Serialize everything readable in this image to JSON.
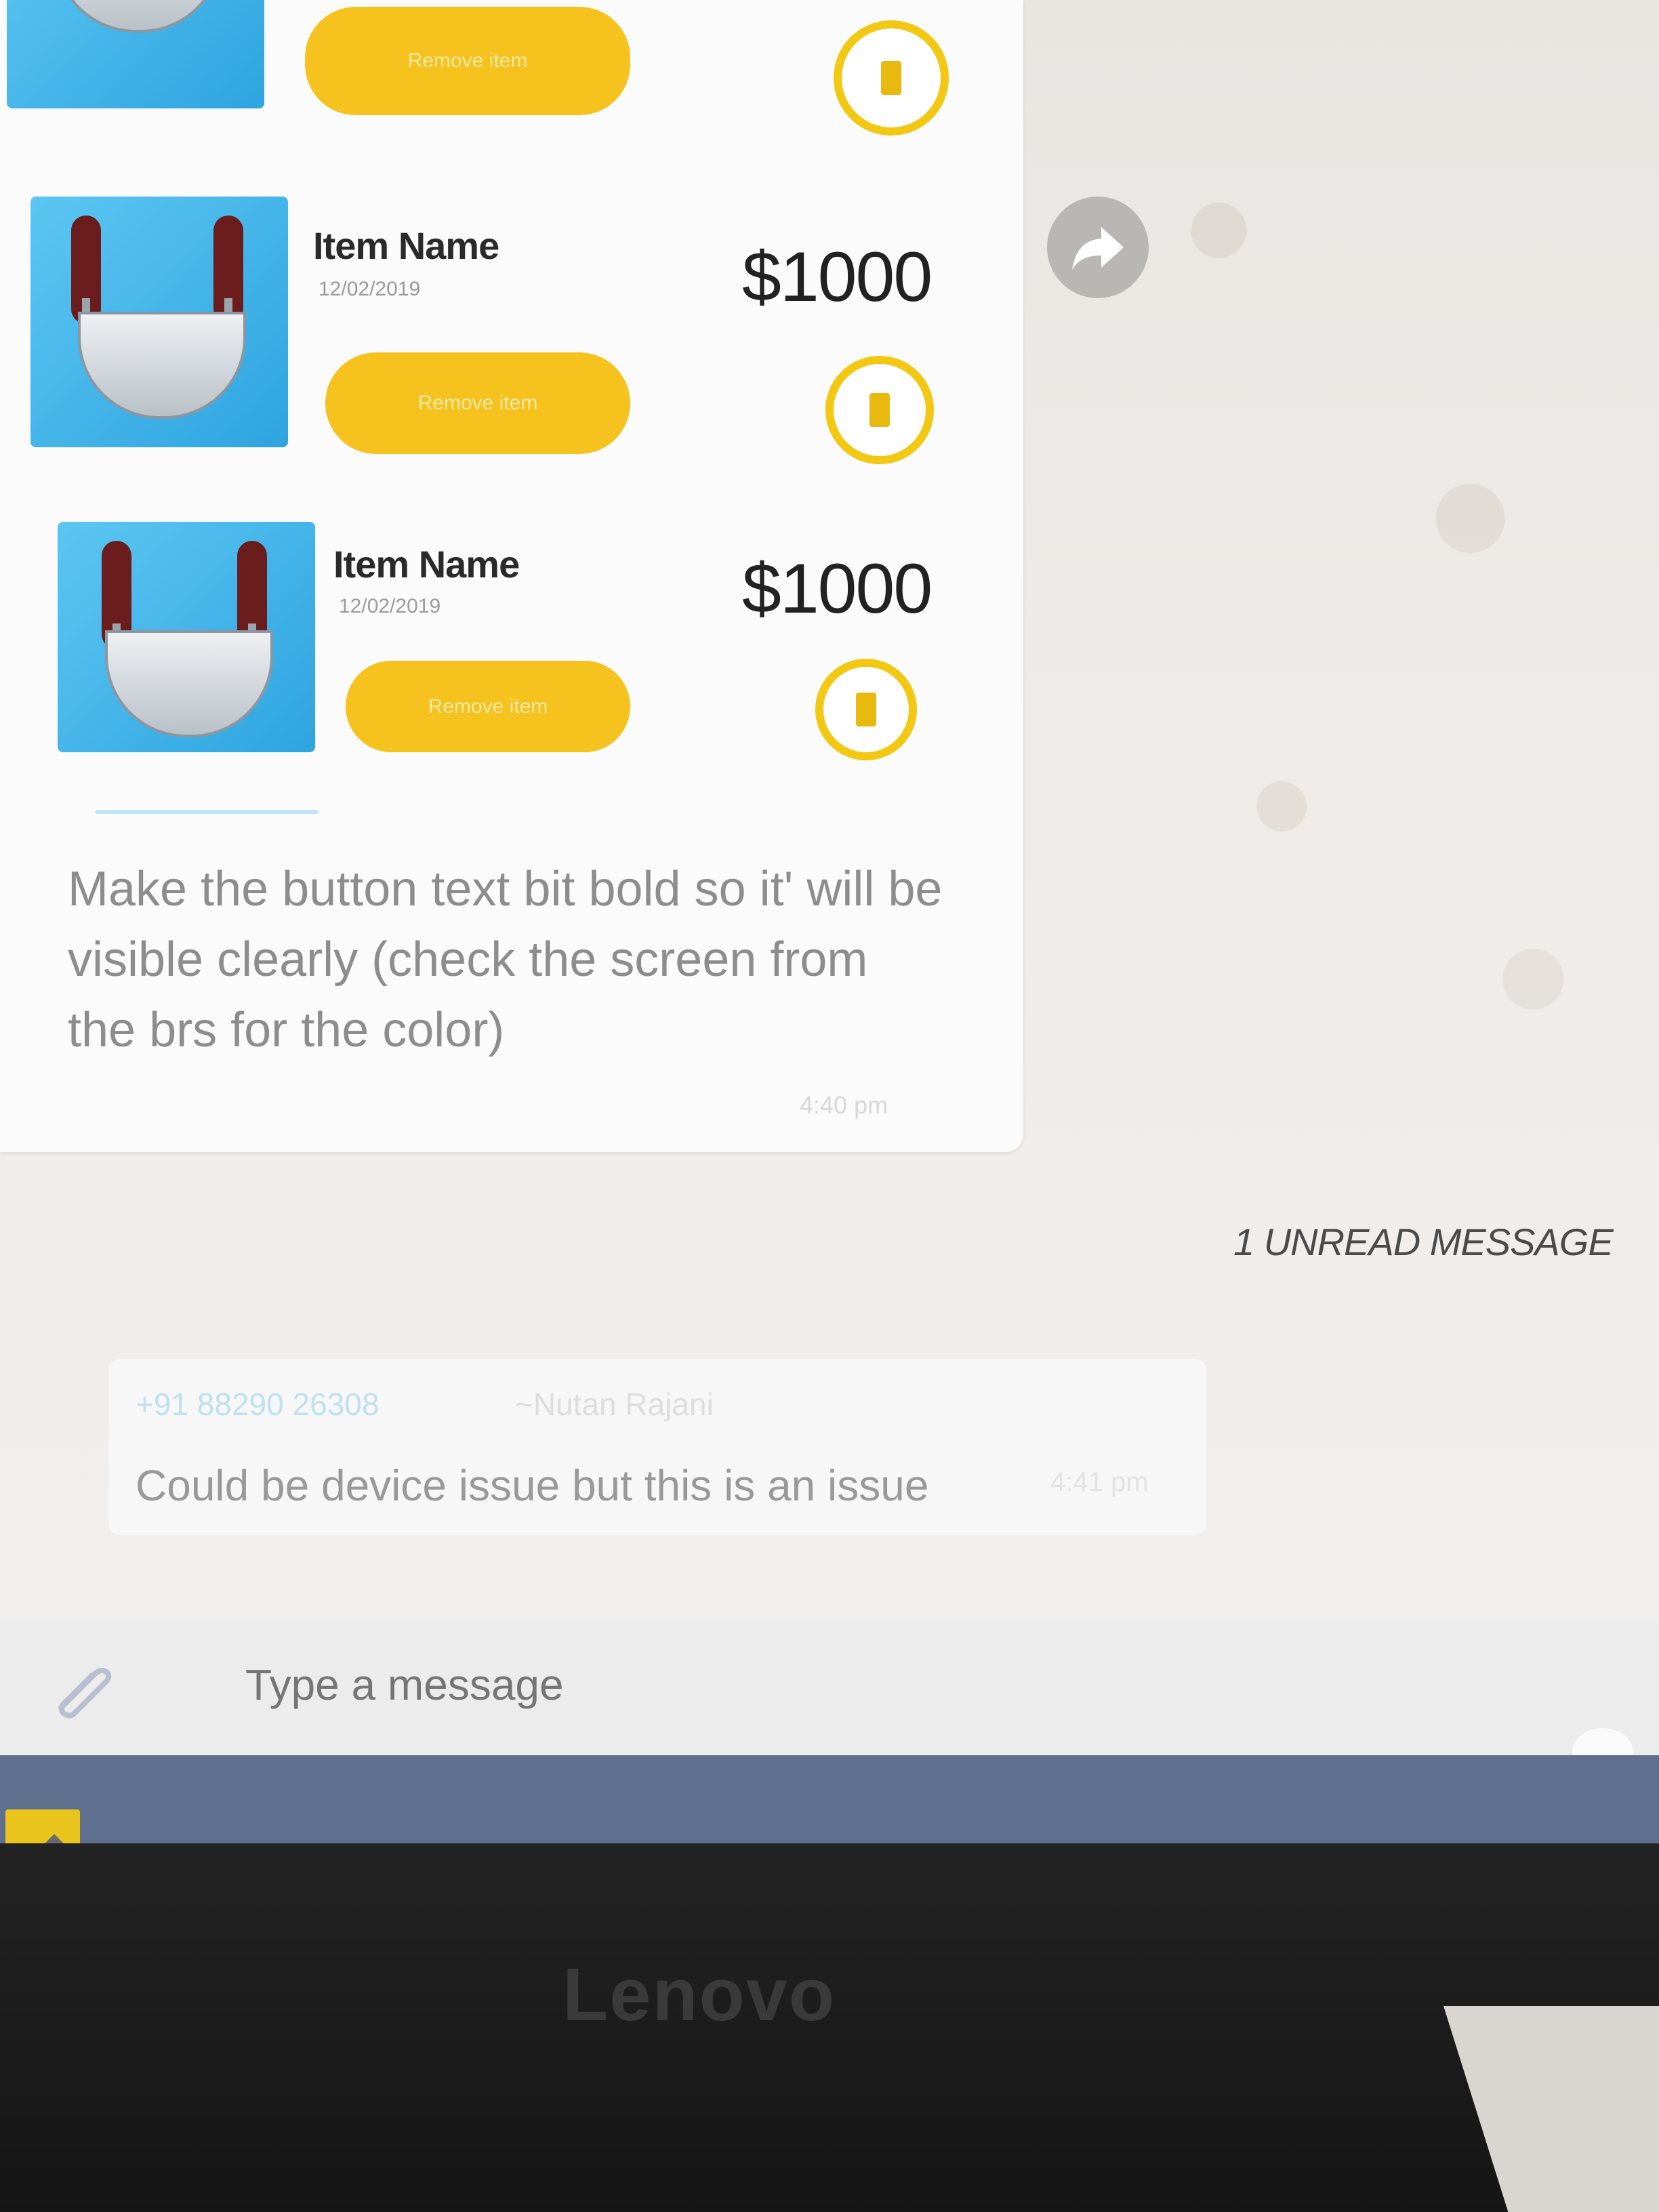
{
  "items": [
    {
      "name": "Item Name",
      "date": "12/02/2019",
      "price": "$1000",
      "button_label": "Remove item"
    },
    {
      "name": "Item Name",
      "date": "12/02/2019",
      "price": "$1000",
      "button_label": "Remove item"
    }
  ],
  "top_button_label": "Remove item",
  "message": {
    "caption": "Make the button text bit bold so it' will be visible clearly (check the screen from the brs for the color)",
    "time": "4:40 pm"
  },
  "unread_banner": "1 UNREAD MESSAGE",
  "incoming": {
    "sender_phone": "+91 88290 26308",
    "sender_name": "~Nutan Rajani",
    "text": "Could be device issue but this is an issue",
    "time": "4:41 pm"
  },
  "compose": {
    "placeholder": "Type a message"
  },
  "brand": "Lenovo",
  "colors": {
    "accent_yellow": "#f6c21e",
    "thumb_blue": "#2ea4e0",
    "taskbar": "#5f6f8e"
  }
}
